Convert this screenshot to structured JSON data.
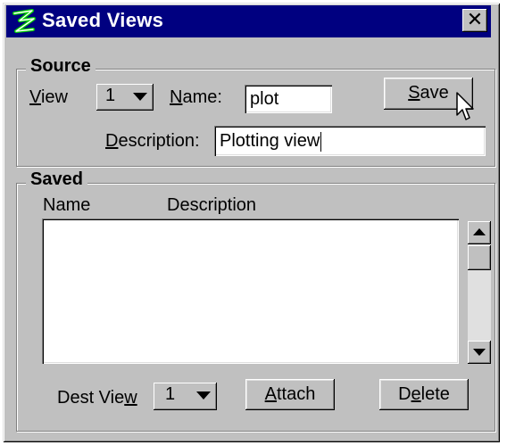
{
  "window": {
    "title": "Saved Views",
    "close_label": "✕"
  },
  "source": {
    "group_title": "Source",
    "view_label_prefix": "",
    "view_label_underline": "V",
    "view_label_rest": "iew",
    "view_value": "1",
    "name_label_underline": "N",
    "name_label_rest": "ame:",
    "name_value": "plot",
    "save_label_underline": "S",
    "save_label_rest": "ave",
    "description_label_underline": "D",
    "description_label_rest": "escription:",
    "description_value": "Plotting view"
  },
  "saved": {
    "group_title": "Saved",
    "columns": [
      "Name",
      "Description"
    ],
    "rows": [],
    "dest_view_label_prefix": "Dest Vie",
    "dest_view_label_underline": "w",
    "dest_view_value": "1",
    "attach_label_underline": "A",
    "attach_label_rest": "ttach",
    "delete_label_prefix": "D",
    "delete_label_underline": "e",
    "delete_label_rest": "lete"
  },
  "colors": {
    "titlebar": "#000080",
    "face": "#c0c0c0"
  },
  "icons": [
    "app-logo-icon",
    "close-icon",
    "chevron-down-icon",
    "scroll-up-icon",
    "scroll-down-icon",
    "mouse-cursor-icon"
  ]
}
